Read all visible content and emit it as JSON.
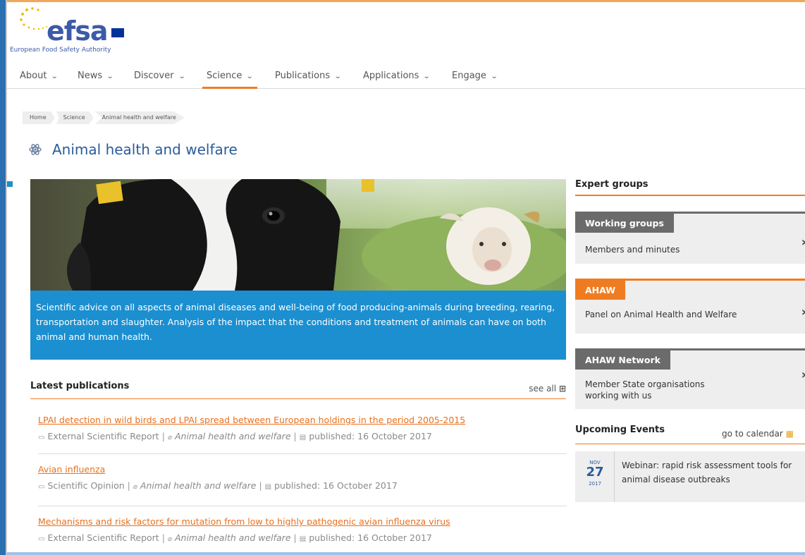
{
  "logo": {
    "wordmark": "efsa",
    "tagline": "European Food Safety Authority"
  },
  "nav": {
    "items": [
      {
        "label": "About"
      },
      {
        "label": "News"
      },
      {
        "label": "Discover"
      },
      {
        "label": "Science",
        "active": true
      },
      {
        "label": "Publications"
      },
      {
        "label": "Applications"
      },
      {
        "label": "Engage"
      }
    ],
    "chevron": "⌄"
  },
  "breadcrumb": [
    "Home",
    "Science",
    "Animal health and welfare"
  ],
  "page": {
    "title": "Animal health and welfare",
    "title_icon": "atom-icon",
    "hero_caption": "Scientific advice on all aspects of animal diseases and well-being of food producing-animals during breeding, rearing, transportation and slaughter. Analysis of the impact that the conditions and treatment of animals can have on both animal and human health."
  },
  "latest": {
    "heading": "Latest publications",
    "see_all": "see all",
    "items": [
      {
        "title": "LPAI detection in wild birds and LPAI spread between European holdings in the period 2005-2015",
        "type": "External Scientific Report",
        "area": "Animal health and welfare",
        "published": "published: 16 October 2017"
      },
      {
        "title": "Avian influenza",
        "type": "Scientific Opinion",
        "area": "Animal health and welfare",
        "published": "published: 16 October 2017"
      },
      {
        "title": "Mechanisms and risk factors for mutation from low to highly pathogenic avian influenza virus",
        "type": "External Scientific Report",
        "area": "Animal health and welfare",
        "published": "published: 16 October 2017"
      }
    ]
  },
  "sidebar": {
    "expert_heading": "Expert groups",
    "cards": [
      {
        "tab": "Working groups",
        "desc": "Members and minutes",
        "color": "#6b6b6b"
      },
      {
        "tab": "AHAW",
        "desc": "Panel on Animal Health and Welfare",
        "color": "#f07c22"
      },
      {
        "tab": "AHAW Network",
        "desc": "Member State organisations working with us",
        "color": "#6b6b6b"
      }
    ],
    "events_heading": "Upcoming Events",
    "go_to_calendar": "go to calendar",
    "event": {
      "month": "NOV",
      "day": "27",
      "year": "2017",
      "title": "Webinar: rapid risk assessment tools for animal disease outbreaks"
    }
  },
  "colors": {
    "accent": "#f07c22",
    "brand_blue": "#2a5c9a",
    "caption_blue": "#1b8fd0"
  }
}
